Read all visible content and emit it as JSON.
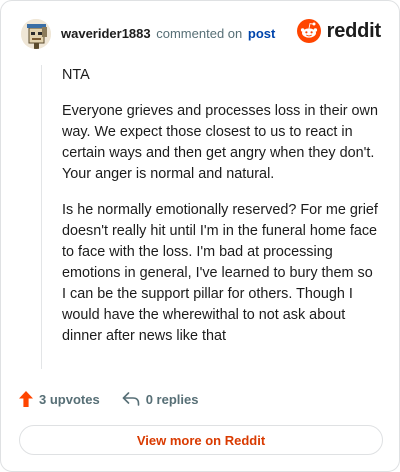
{
  "header": {
    "username": "waverider1883",
    "commented_text": "commented on",
    "post_link": "post",
    "brand": "reddit"
  },
  "comment": {
    "paragraphs": [
      "NTA",
      "Everyone grieves and processes loss in their own way. We expect those closest to us to react in certain ways and then get angry when they don't. Your anger is normal and natural.",
      "Is he normally emotionally reserved? For me grief doesn't really hit until I'm in the funeral home face to face with the loss. I'm bad at processing emotions in general, I've learned to bury them so I can be the support pillar for others. Though I would have the wherewithal to not ask about dinner after news like that"
    ]
  },
  "footer": {
    "upvotes": "3 upvotes",
    "replies": "0 replies",
    "view_more": "View more on Reddit"
  },
  "icons": {
    "upvote": "upvote-arrow-icon",
    "reply": "reply-arrow-icon",
    "logo": "reddit-logo-icon"
  },
  "colors": {
    "brand": "#ff4500",
    "link": "#0045ac",
    "muted": "#576f76",
    "cta": "#d93a00"
  }
}
